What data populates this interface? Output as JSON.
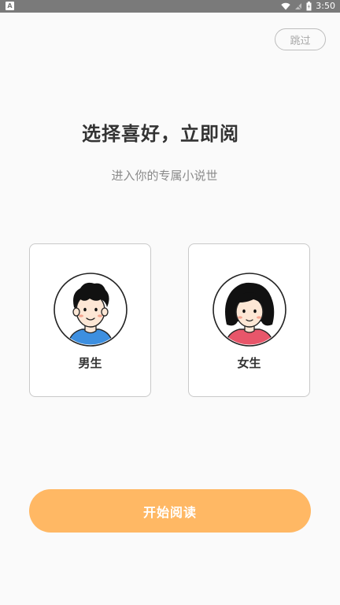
{
  "status_bar": {
    "app_badge": "A",
    "time": "3:50"
  },
  "skip_label": "跳过",
  "title": "选择喜好，立即阅",
  "subtitle": "进入你的专属小说世",
  "options": [
    {
      "label": "男生",
      "icon": "boy-avatar-icon",
      "shirt_color": "#3d8fe0"
    },
    {
      "label": "女生",
      "icon": "girl-avatar-icon",
      "shirt_color": "#e8566a"
    }
  ],
  "start_label": "开始阅读",
  "colors": {
    "accent": "#ffb864",
    "background": "#fafafa"
  }
}
